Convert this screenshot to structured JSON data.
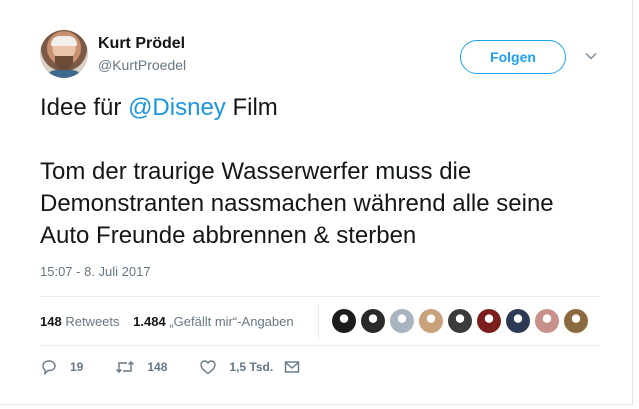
{
  "author": {
    "name": "Kurt Prödel",
    "handle": "@KurtProedel",
    "avatar_icon": "avatar-photo"
  },
  "follow_label": "Folgen",
  "tweet": {
    "line1_pre": "Idee für ",
    "mention": "@Disney",
    "line1_post": " Film",
    "body": "Tom der traurige Wasserwerfer muss die Demonstranten nassmachen während alle seine Auto Freunde abbrennen & sterben"
  },
  "timestamp": "15:07 - 8. Juli 2017",
  "stats": {
    "retweets_count": "148",
    "retweets_label": "Retweets",
    "likes_count": "1.484",
    "likes_label": "„Gefällt mir“-Angaben"
  },
  "likers": [
    "#1b1b1b",
    "#2a2a2a",
    "#a8b4bf",
    "#c7a27a",
    "#3b3b3b",
    "#7a1e1e",
    "#2d3a55",
    "#c98f8a",
    "#8a6a3e"
  ],
  "actions": {
    "reply_count": "19",
    "retweet_count": "148",
    "like_count": "1,5 Tsd."
  },
  "colors": {
    "accent": "#1da1f2",
    "mention": "#1b95e0",
    "muted": "#657786"
  }
}
